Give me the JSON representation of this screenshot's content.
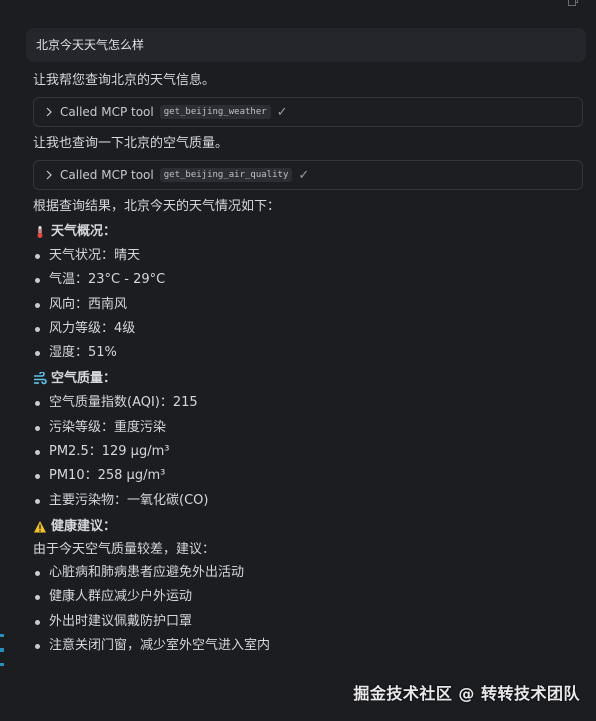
{
  "user_message": "北京今天天气怎么样",
  "assistant": {
    "intro_1": "让我帮您查询北京的天气信息。",
    "tool_call_1": {
      "label": "Called MCP tool",
      "tool": "get_beijing_weather",
      "status": "✓"
    },
    "intro_2": "让我也查询一下北京的空气质量。",
    "tool_call_2": {
      "label": "Called MCP tool",
      "tool": "get_beijing_air_quality",
      "status": "✓"
    },
    "summary": "根据查询结果，北京今天的天气情况如下：",
    "weather": {
      "heading": "天气概况：",
      "icon": "thermometer-icon",
      "items": [
        "天气状况：晴天",
        "气温：23°C - 29°C",
        "风向：西南风",
        "风力等级：4级",
        "湿度：51%"
      ]
    },
    "air": {
      "heading": "空气质量：",
      "icon": "wind-icon",
      "items": [
        "空气质量指数(AQI)：215",
        "污染等级：重度污染",
        "PM2.5：129 μg/m³",
        "PM10：258 μg/m³",
        "主要污染物：一氧化碳(CO)"
      ]
    },
    "health": {
      "heading": "健康建议：",
      "icon": "warning-icon",
      "intro": "由于今天空气质量较差，建议：",
      "items": [
        "心脏病和肺病患者应避免外出活动",
        "健康人群应减少户外运动",
        "外出时建议佩戴防护口罩",
        "注意关闭门窗，减少室外空气进入室内"
      ]
    }
  },
  "watermark": "掘金技术社区 @ 转转技术团队",
  "colors": {
    "background": "#1c1d21",
    "user_bubble": "#25262b",
    "accent_edge": "#2a8fb8"
  }
}
